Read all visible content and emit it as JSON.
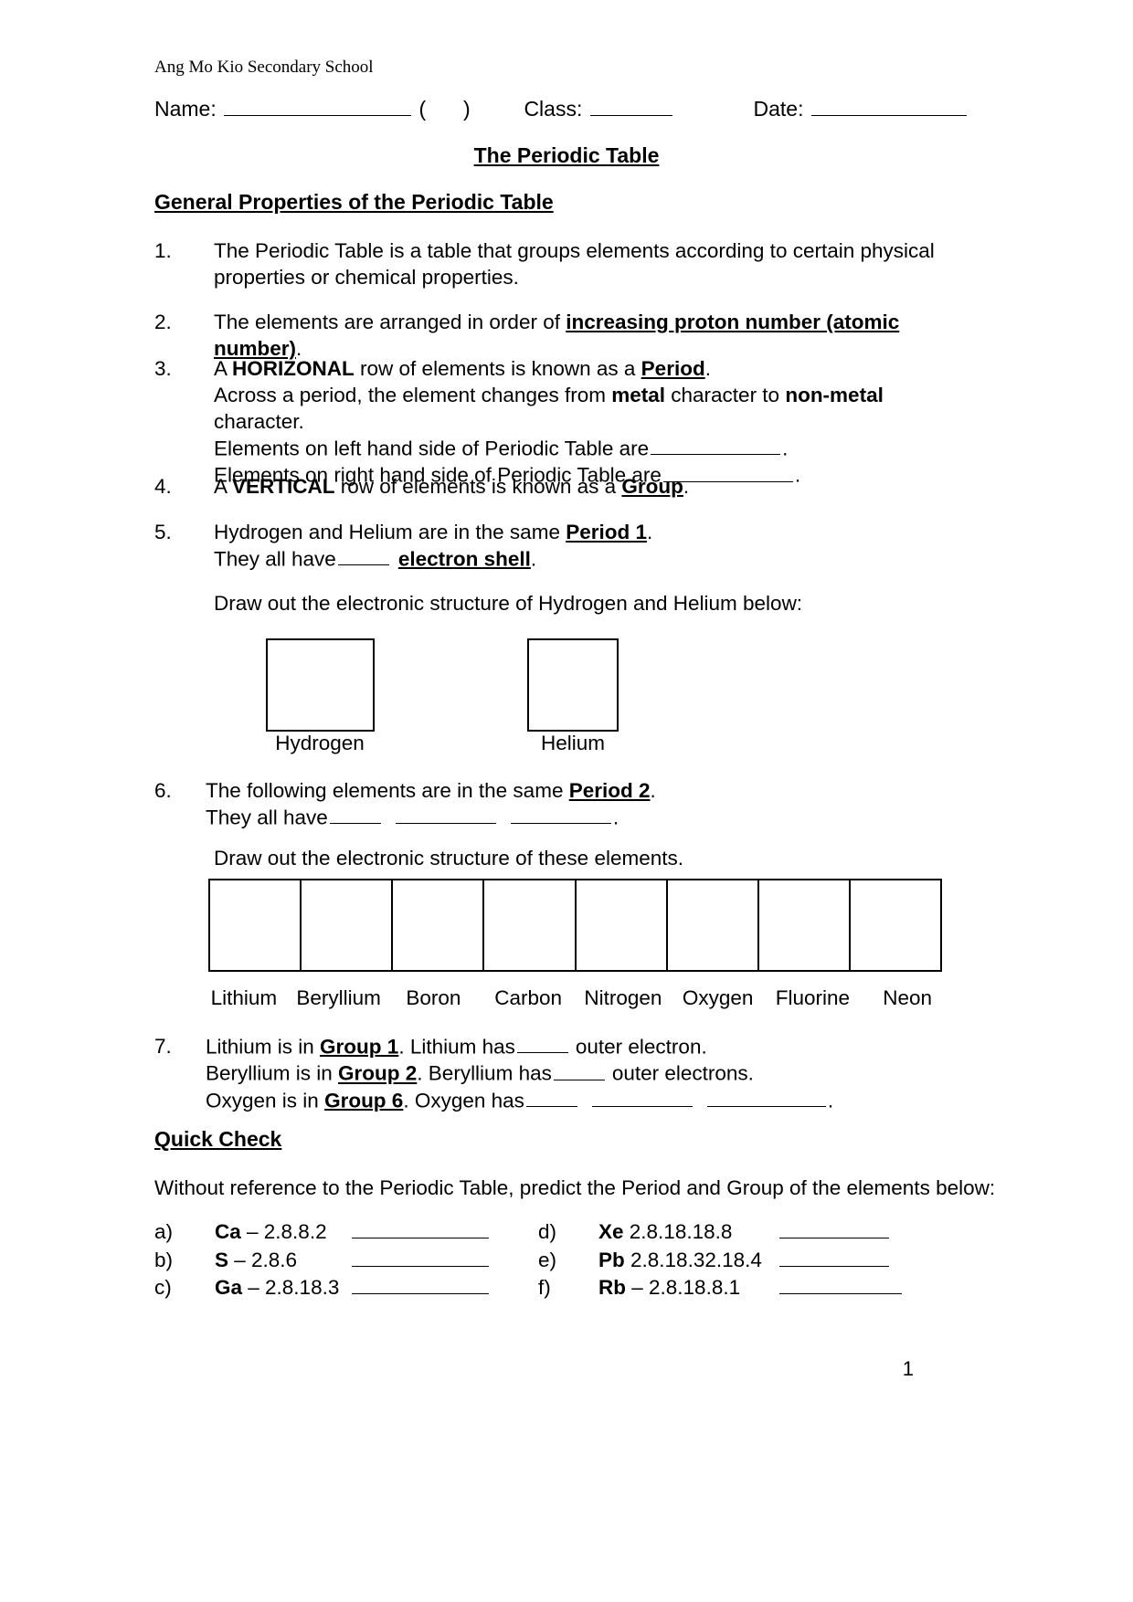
{
  "header": {
    "school": "Ang Mo Kio Secondary School",
    "name_label": "Name:",
    "paren_open": "(",
    "paren_close": ")",
    "class_label": "Class:",
    "date_label": "Date:"
  },
  "title": "The Periodic Table",
  "sections": {
    "general_heading": "General Properties of the Periodic Table",
    "quick_check_heading": "Quick Check"
  },
  "items": {
    "n1": {
      "num": "1.",
      "line1": "The Periodic Table is a table that groups elements according to certain physical",
      "line2": "properties or chemical properties."
    },
    "n2": {
      "num": "2.",
      "pre": "The elements are arranged in order of ",
      "bold_underline": "increasing proton number (atomic number)",
      "post": "."
    },
    "n3": {
      "num": "3.",
      "l1_a": "A ",
      "l1_bold": "HORIZONAL",
      "l1_b": " row of elements is known as a ",
      "l1_bu": "Period",
      "l1_c": ".",
      "l2_a": "Across a period, the element changes from ",
      "l2_bold1": "metal",
      "l2_b": " character to ",
      "l2_bold2": "non-metal",
      "l2_c": " character.",
      "l3_a": "Elements on left hand side of Periodic Table are",
      "l3_b": ".",
      "l4_a": "Elements on right hand side of Periodic Table are",
      "l4_b": "."
    },
    "n4": {
      "num": "4.",
      "a": "A ",
      "bold": "VERTICAL",
      "b": " row of elements is known as a ",
      "bu": "Group",
      "c": "."
    },
    "n5": {
      "num": "5.",
      "l1_a": "Hydrogen and Helium are in the same ",
      "l1_bu": "Period 1",
      "l1_b": ".",
      "l2_a": "They all have",
      "l2_bu": "electron shell",
      "l2_b": ".",
      "draw_instruction": "Draw out the electronic structure of Hydrogen and Helium below:",
      "box_labels": [
        "Hydrogen",
        "Helium"
      ]
    },
    "n6": {
      "num": "6.",
      "l1_a": "The following elements are in the same ",
      "l1_bu": "Period 2",
      "l1_b": ".",
      "l2_a": "They all have",
      "l2_end": ".",
      "draw_instruction": "Draw out the electronic structure of these elements.",
      "element_labels": [
        "Lithium",
        "Beryllium",
        "Boron",
        "Carbon",
        "Nitrogen",
        "Oxygen",
        "Fluorine",
        "Neon"
      ]
    },
    "n7": {
      "num": "7.",
      "l1_a": "Lithium is in ",
      "l1_bu": "Group 1",
      "l1_b": ". Lithium has",
      "l1_c": "outer electron.",
      "l2_a": "Beryllium is in ",
      "l2_bu": "Group 2",
      "l2_b": ". Beryllium has",
      "l2_c": "outer electrons.",
      "l3_a": "Oxygen is in ",
      "l3_bu": "Group 6",
      "l3_b": ". Oxygen has",
      "l3_end": "."
    }
  },
  "quick_check": {
    "instruction": "Without reference to the Periodic Table, predict the Period and Group of the elements below:",
    "rows": [
      {
        "left_letter": "a)",
        "left_symbol": "Ca",
        "left_config": " – 2.8.8.2",
        "right_letter": "d)",
        "right_symbol": "Xe",
        "right_config": " 2.8.18.18.8"
      },
      {
        "left_letter": "b)",
        "left_symbol": "S",
        "left_config": " – 2.8.6",
        "right_letter": "e)",
        "right_symbol": "Pb",
        "right_config": " 2.8.18.32.18.4"
      },
      {
        "left_letter": "c)",
        "left_symbol": "Ga",
        "left_config": " – 2.8.18.3",
        "right_letter": "f)",
        "right_symbol": "Rb",
        "right_config": " – 2.8.18.8.1"
      }
    ]
  },
  "page_number": "1"
}
